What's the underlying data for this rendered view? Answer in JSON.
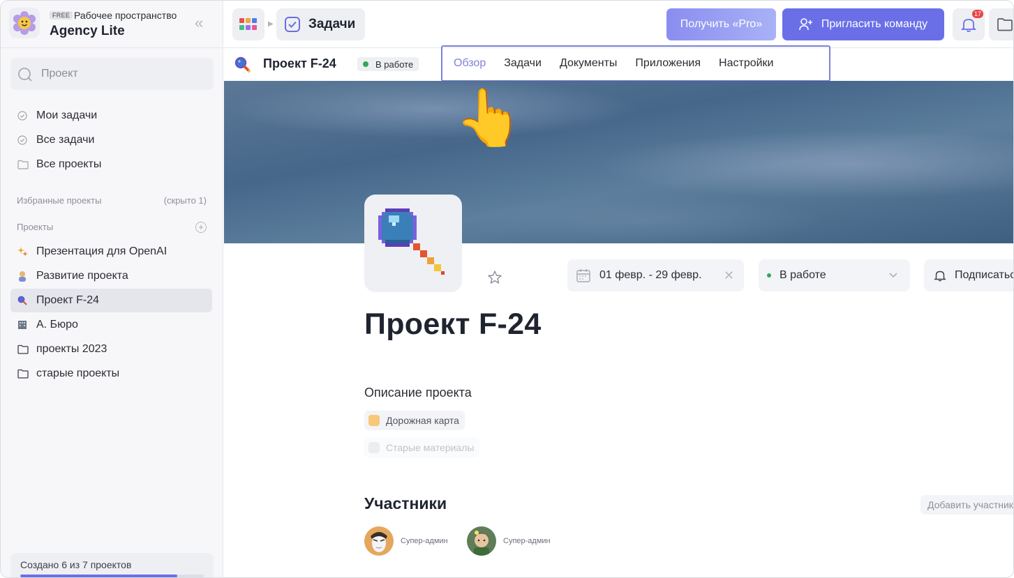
{
  "workspace": {
    "badge": "FREE",
    "label": "Рабочее пространство",
    "name": "Agency Lite"
  },
  "search": {
    "placeholder": "Проект"
  },
  "nav": [
    {
      "label": "Мои задачи",
      "icon": "check-circle-icon"
    },
    {
      "label": "Все задачи",
      "icon": "check-circle-icon"
    },
    {
      "label": "Все проекты",
      "icon": "folder-icon"
    }
  ],
  "favorites": {
    "label": "Избранные проекты",
    "hidden": "(скрыто 1)"
  },
  "projects_section": {
    "label": "Проекты"
  },
  "projects": [
    {
      "label": "Презентация для OpenAI",
      "icon": "sparkle-icon",
      "color": "#f39c2b"
    },
    {
      "label": "Развитие проекта",
      "icon": "person-icon",
      "color": "#e8b86a"
    },
    {
      "label": "Проект F-24",
      "icon": "magnifier-icon",
      "color": "#4a6fd0",
      "active": true
    },
    {
      "label": "А. Бюро",
      "icon": "building-icon",
      "color": "#6d7685"
    },
    {
      "label": "проекты 2023",
      "icon": "folder-icon"
    },
    {
      "label": "старые проекты",
      "icon": "folder-icon"
    }
  ],
  "quota": {
    "text": "Создано 6 из 7 проектов",
    "progress": 0.857
  },
  "topbar": {
    "breadcrumb": "Задачи",
    "pro_button": "Получить «Pro»",
    "invite_button": "Пригласить команду",
    "notifications": "17"
  },
  "project": {
    "title": "Проект F-24",
    "status": "В работе",
    "tabs": [
      "Обзор",
      "Задачи",
      "Документы",
      "Приложения",
      "Настройки"
    ],
    "active_tab": "Обзор",
    "date_range": "01 февр. - 29 февр.",
    "status_select": "В работе",
    "subscribe": "Подписаться",
    "big_title": "Проект F-24",
    "description_label": "Описание проекта",
    "docs": [
      {
        "label": "Дорожная карта",
        "color": "#f7c77a"
      },
      {
        "label": "Старые материалы",
        "color": "#c9ccd3"
      }
    ],
    "members_title": "Участники",
    "add_member": "Добавить участника",
    "members": [
      {
        "role": "Супер-админ"
      },
      {
        "role": "Супер-админ"
      }
    ]
  },
  "colors": {
    "accent": "#6a6fe8",
    "status_green": "#33a852",
    "tab_active": "#7d82d8"
  }
}
